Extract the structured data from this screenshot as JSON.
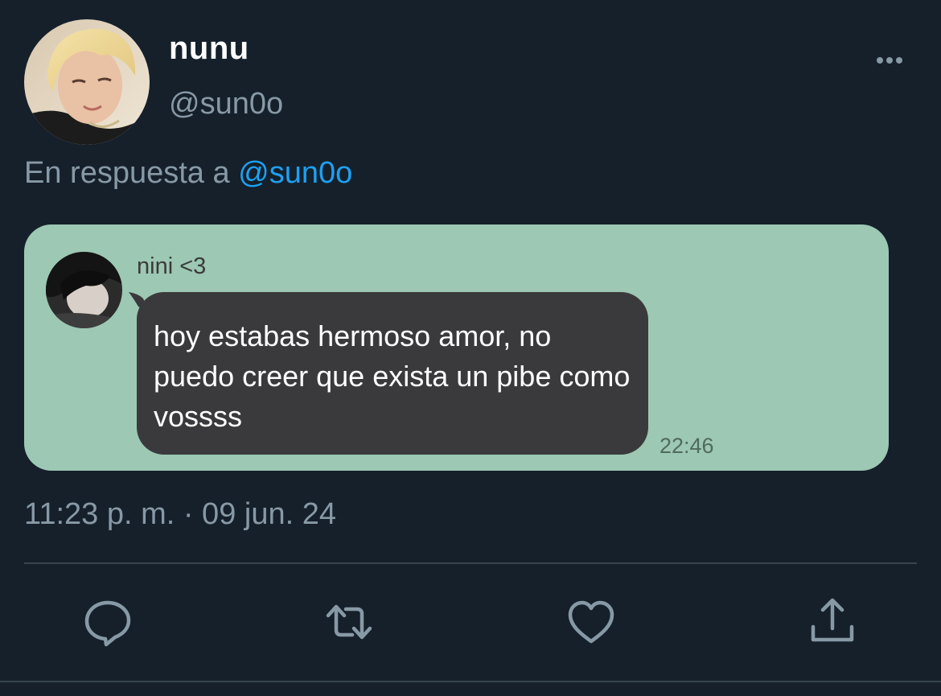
{
  "tweet": {
    "author": {
      "display_name": "nunu",
      "handle": "@sun0o",
      "avatar": "profile-photo-blonde"
    },
    "more_icon": "more-horizontal-icon",
    "reply": {
      "prefix": "En respuesta a",
      "handle": "@sun0o"
    },
    "timestamp": "11:23 p. m. · 09 jun. 24"
  },
  "chat_screenshot": {
    "background": "#9dc8b4",
    "bubble_color": "#3a3a3c",
    "sender": "nini <3",
    "message": "hoy estabas hermoso amor, no puedo creer que exista un pibe como vossss",
    "time": "22:46"
  },
  "actions": [
    {
      "name": "reply",
      "icon": "comment-icon"
    },
    {
      "name": "retweet",
      "icon": "retweet-icon"
    },
    {
      "name": "like",
      "icon": "heart-icon"
    },
    {
      "name": "share",
      "icon": "share-icon"
    }
  ],
  "colors": {
    "background": "#15202b",
    "muted_text": "#8899a6",
    "link": "#1da1f2",
    "divider": "#38444d"
  }
}
